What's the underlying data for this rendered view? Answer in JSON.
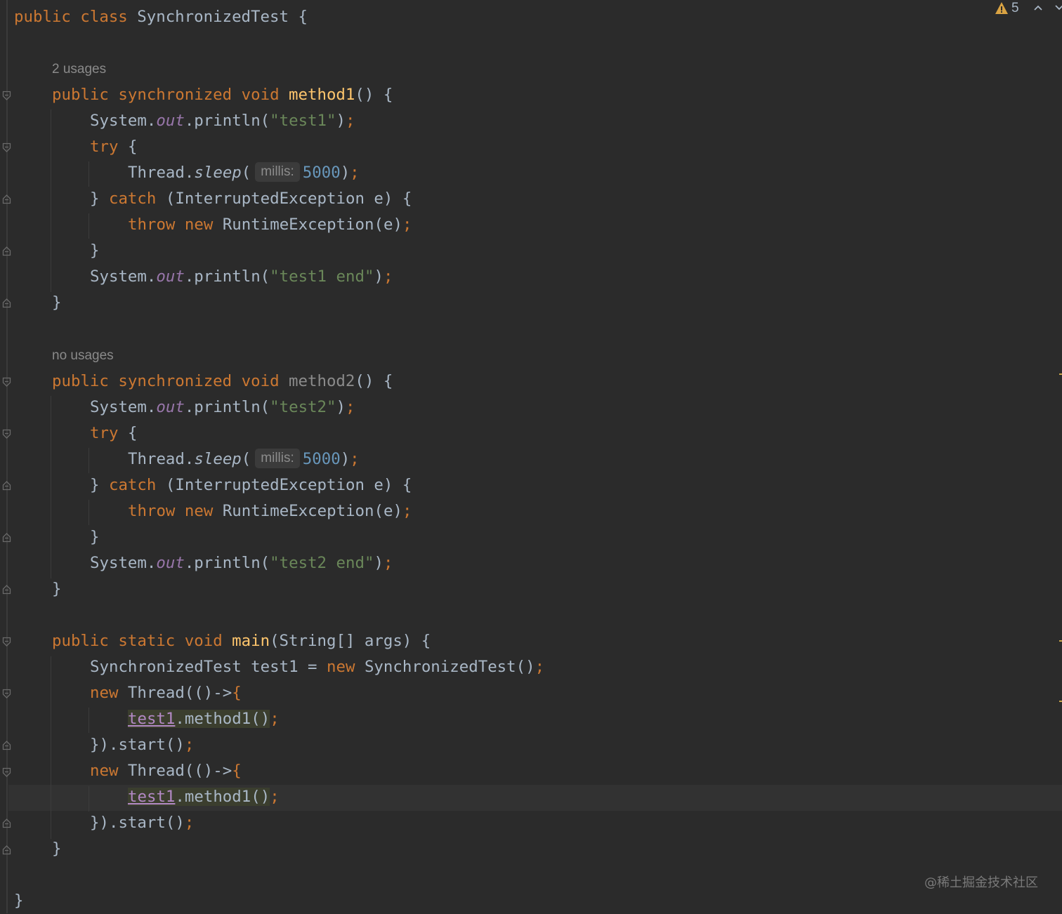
{
  "editor": {
    "class_keywords": [
      "public",
      "class"
    ],
    "class_name": "SynchronizedTest",
    "open_brace": "{",
    "close_brace": "}",
    "method1": {
      "usages": "2 usages",
      "modifiers": [
        "public",
        "synchronized",
        "void"
      ],
      "name": "method1",
      "print1": "\"test1\"",
      "print2": "\"test1 end\""
    },
    "method2": {
      "usages": "no usages",
      "modifiers": [
        "public",
        "synchronized",
        "void"
      ],
      "name": "method2",
      "print1": "\"test2\"",
      "print2": "\"test2 end\""
    },
    "main": {
      "modifiers": [
        "public",
        "static",
        "void"
      ],
      "name": "main",
      "params": "(String[] args) {",
      "decl_type": "SynchronizedTest test1 = ",
      "ctor": " SynchronizedTest()",
      "var": "test1",
      "call": ".method1()",
      "thread_open": " Thread(()->",
      "thread_close": "}).start()"
    },
    "tokens": {
      "system": "System.",
      "out": "out",
      "println": ".println(",
      "close_call": ")",
      "semicolon": ";",
      "try": "try",
      "thread_sleep": "Thread.",
      "sleep": "sleep",
      "paren_open": "(",
      "param_hint": "millis:",
      "sleep_value": "5000",
      "catch_prefix": "} ",
      "catch": "catch",
      "catch_args": " (InterruptedException e) {",
      "throw": "throw",
      "new": "new",
      "runtime_exception": " RuntimeException(e)",
      "brace_open": "{",
      "brace_close": "}",
      "empty_parens": "() {"
    }
  },
  "inspections": {
    "warning_count": "5"
  },
  "watermark": "@稀土掘金技术社区",
  "colors": {
    "background": "#2b2b2b",
    "keyword": "#cc7832",
    "method_decl": "#ffc66d",
    "string": "#6a8759",
    "number": "#6897bb",
    "field": "#9876aa",
    "text": "#a9b7c6"
  }
}
